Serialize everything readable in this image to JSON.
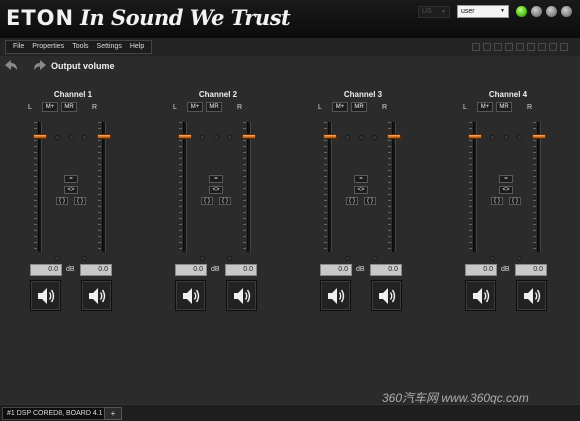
{
  "titlebar": {
    "brand": "ETON",
    "slogan": "In Sound We Trust",
    "language_value": "US",
    "user_value": "user"
  },
  "menu": [
    "File",
    "Properties",
    "Tools",
    "Settings",
    "Help"
  ],
  "page": {
    "title": "Output volume"
  },
  "channel_common": {
    "left_label": "L",
    "right_label": "R",
    "m_plus_label": "M+",
    "mr_label": "MR",
    "eq_label": "=",
    "swap_label": "<>",
    "paren_label": "( )",
    "db_label": "dB",
    "volume_left": "0.0",
    "volume_right": "0.0"
  },
  "channels": [
    {
      "name": "Channel 1"
    },
    {
      "name": "Channel 2"
    },
    {
      "name": "Channel 3"
    },
    {
      "name": "Channel 4"
    }
  ],
  "status": {
    "device_tab": "#1 DSP CORED8, BOARD 4.1",
    "add_label": "+"
  },
  "watermark": "360汽车网 www.360qc.com",
  "colors": {
    "accent_green": "#3fb60f",
    "fader_orange": "#d9751f",
    "background": "#2b2b2b"
  },
  "icons": [
    "back-arrow-icon",
    "forward-arrow-icon",
    "speaker-icon"
  ]
}
